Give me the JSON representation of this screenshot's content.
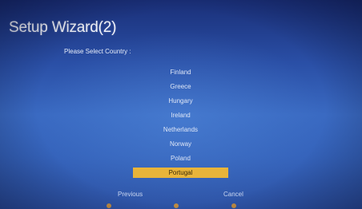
{
  "window": {
    "title": "Setup Wizard(2)"
  },
  "prompt": "Please Select Country :",
  "countries": [
    "Finland",
    "Greece",
    "Hungary",
    "Ireland",
    "Netherlands",
    "Norway",
    "Poland",
    "Portugal"
  ],
  "selected_country": "Portugal",
  "buttons": {
    "previous": "Previous",
    "cancel": "Cancel"
  },
  "colors": {
    "background": "#2a4fa6",
    "highlight": "#e8b43a",
    "text": "#dfe7f7"
  },
  "key_hints": [
    {
      "icon": "orange-key-icon"
    },
    {
      "icon": "orange-key-icon"
    },
    {
      "icon": "orange-key-icon"
    }
  ]
}
